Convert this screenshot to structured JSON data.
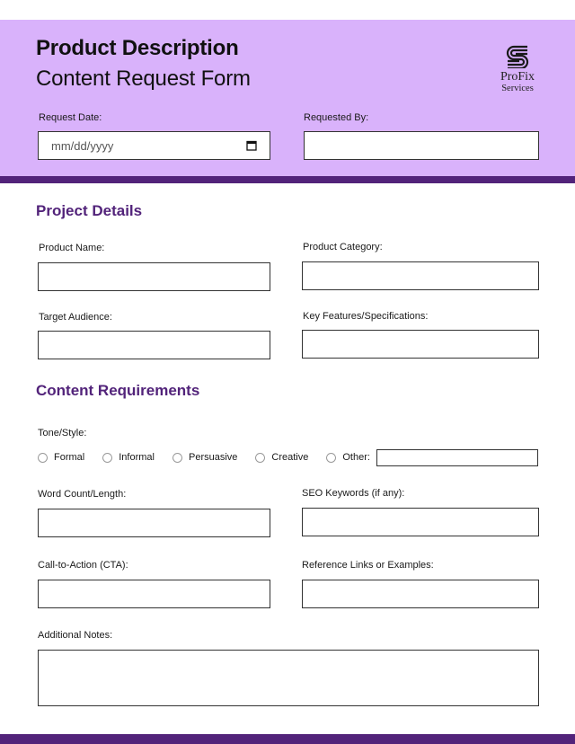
{
  "header": {
    "title": "Product Description",
    "subtitle": "Content Request Form",
    "logo": {
      "icon": "profix-s-logo-icon",
      "name": "ProFix",
      "tagline": "Services"
    },
    "request_date": {
      "label": "Request Date:",
      "placeholder": "mm/dd/yyyy",
      "icon": "calendar-icon",
      "value": ""
    },
    "requested_by": {
      "label": "Requested By:",
      "value": ""
    }
  },
  "project_details": {
    "title": "Project Details",
    "fields": [
      {
        "label": "Product Name:",
        "value": ""
      },
      {
        "label": "Product Category:",
        "value": ""
      },
      {
        "label": "Target Audience:",
        "value": ""
      },
      {
        "label": "Key Features/Specifications:",
        "value": ""
      }
    ]
  },
  "content_requirements": {
    "title": "Content Requirements",
    "tone_label": "Tone/Style:",
    "tone_options": [
      "Formal",
      "Informal",
      "Persuasive",
      "Creative",
      "Other:"
    ],
    "tone_selected": null,
    "other_value": "",
    "fields": [
      {
        "label": "Word Count/Length:",
        "value": ""
      },
      {
        "label": "SEO Keywords (if any):",
        "value": ""
      },
      {
        "label": "Call-to-Action (CTA):",
        "value": ""
      },
      {
        "label": "Reference Links or Examples:",
        "value": ""
      }
    ],
    "notes": {
      "label": "Additional Notes:",
      "value": ""
    }
  },
  "colors": {
    "header_bg": "#d9b2fb",
    "accent": "#52237a"
  }
}
